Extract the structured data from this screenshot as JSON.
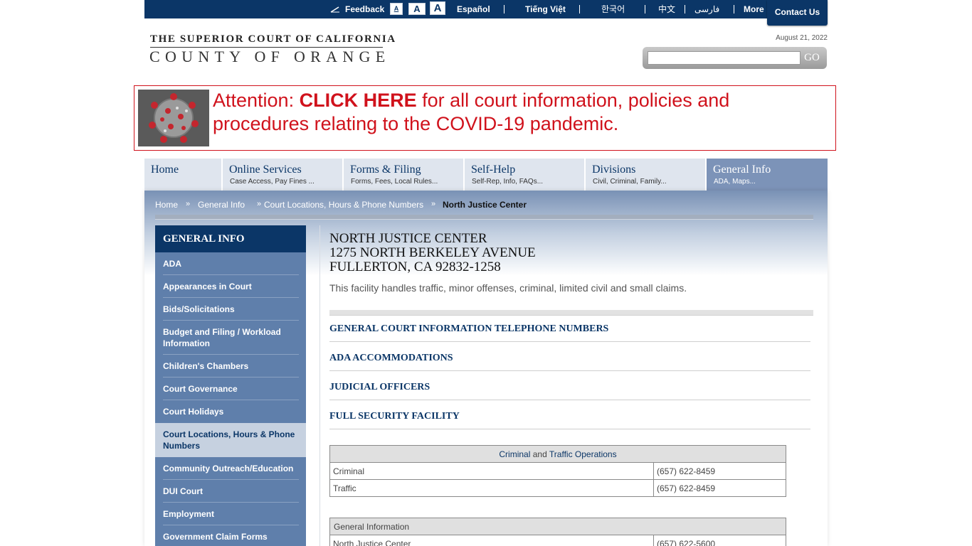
{
  "topbar": {
    "feedback": "Feedback",
    "font_small": "A",
    "font_medium": "A",
    "font_large": "A",
    "languages": [
      "Español",
      "Tiếng Việt",
      "한국어",
      "中文",
      "فارسی"
    ],
    "more": "More",
    "contact": "Contact Us"
  },
  "logo": {
    "line1": "THE SUPERIOR COURT OF CALIFORNIA",
    "line2": "COUNTY OF ORANGE"
  },
  "date": "August 21, 2022",
  "search": {
    "placeholder": "",
    "go": "GO"
  },
  "banner": {
    "prefix": "Attention: ",
    "link": "CLICK HERE",
    "suffix": " for all court information, policies and procedures relating to the COVID-19 pandemic."
  },
  "nav": [
    {
      "title": "Home",
      "sub": ""
    },
    {
      "title": "Online Services",
      "sub": "Case Access, Pay Fines ..."
    },
    {
      "title": "Forms & Filing",
      "sub": "Forms, Fees, Local Rules..."
    },
    {
      "title": "Self-Help",
      "sub": "Self-Rep, Info, FAQs..."
    },
    {
      "title": "Divisions",
      "sub": "Civil, Criminal, Family..."
    },
    {
      "title": "General Info",
      "sub": "ADA, Maps..."
    }
  ],
  "breadcrumb": {
    "items": [
      "Home",
      "General Info",
      "Court Locations, Hours & Phone Numbers",
      "North Justice Center"
    ],
    "separator": "»"
  },
  "sidebar": {
    "heading": "GENERAL INFO",
    "items": [
      "ADA",
      "Appearances in Court",
      "Bids/Solicitations",
      "Budget and Filing / Workload Information",
      "Children's Chambers",
      "Court Governance",
      "Court Holidays",
      "Court Locations, Hours & Phone Numbers",
      "Community Outreach/Education",
      "DUI Court",
      "Employment",
      "Government Claim Forms"
    ]
  },
  "main": {
    "address_lines": [
      "NORTH JUSTICE CENTER",
      "1275 NORTH BERKELEY AVENUE",
      "FULLERTON, CA 92832-1258"
    ],
    "description": "This facility handles traffic, minor offenses, criminal, limited civil and small claims.",
    "accordions": [
      "GENERAL COURT INFORMATION TELEPHONE NUMBERS",
      "ADA ACCOMMODATIONS",
      "JUDICIAL OFFICERS",
      "FULL SECURITY FACILITY"
    ],
    "table1": {
      "header_a": "Criminal",
      "header_and": " and ",
      "header_b": "Traffic Operations",
      "rows": [
        {
          "label": "Criminal",
          "phone": "(657) 622-8459"
        },
        {
          "label": "Traffic",
          "phone": "(657) 622-8459"
        }
      ]
    },
    "table2": {
      "header": "General Information",
      "rows": [
        {
          "label": "North Justice Center",
          "phone": "(657) 622-5600"
        }
      ]
    }
  },
  "colors": {
    "navy": "#0b3667",
    "sidebar": "#5f7fab",
    "alert_red": "#d0121c",
    "active_tab": "#7c93b8"
  }
}
